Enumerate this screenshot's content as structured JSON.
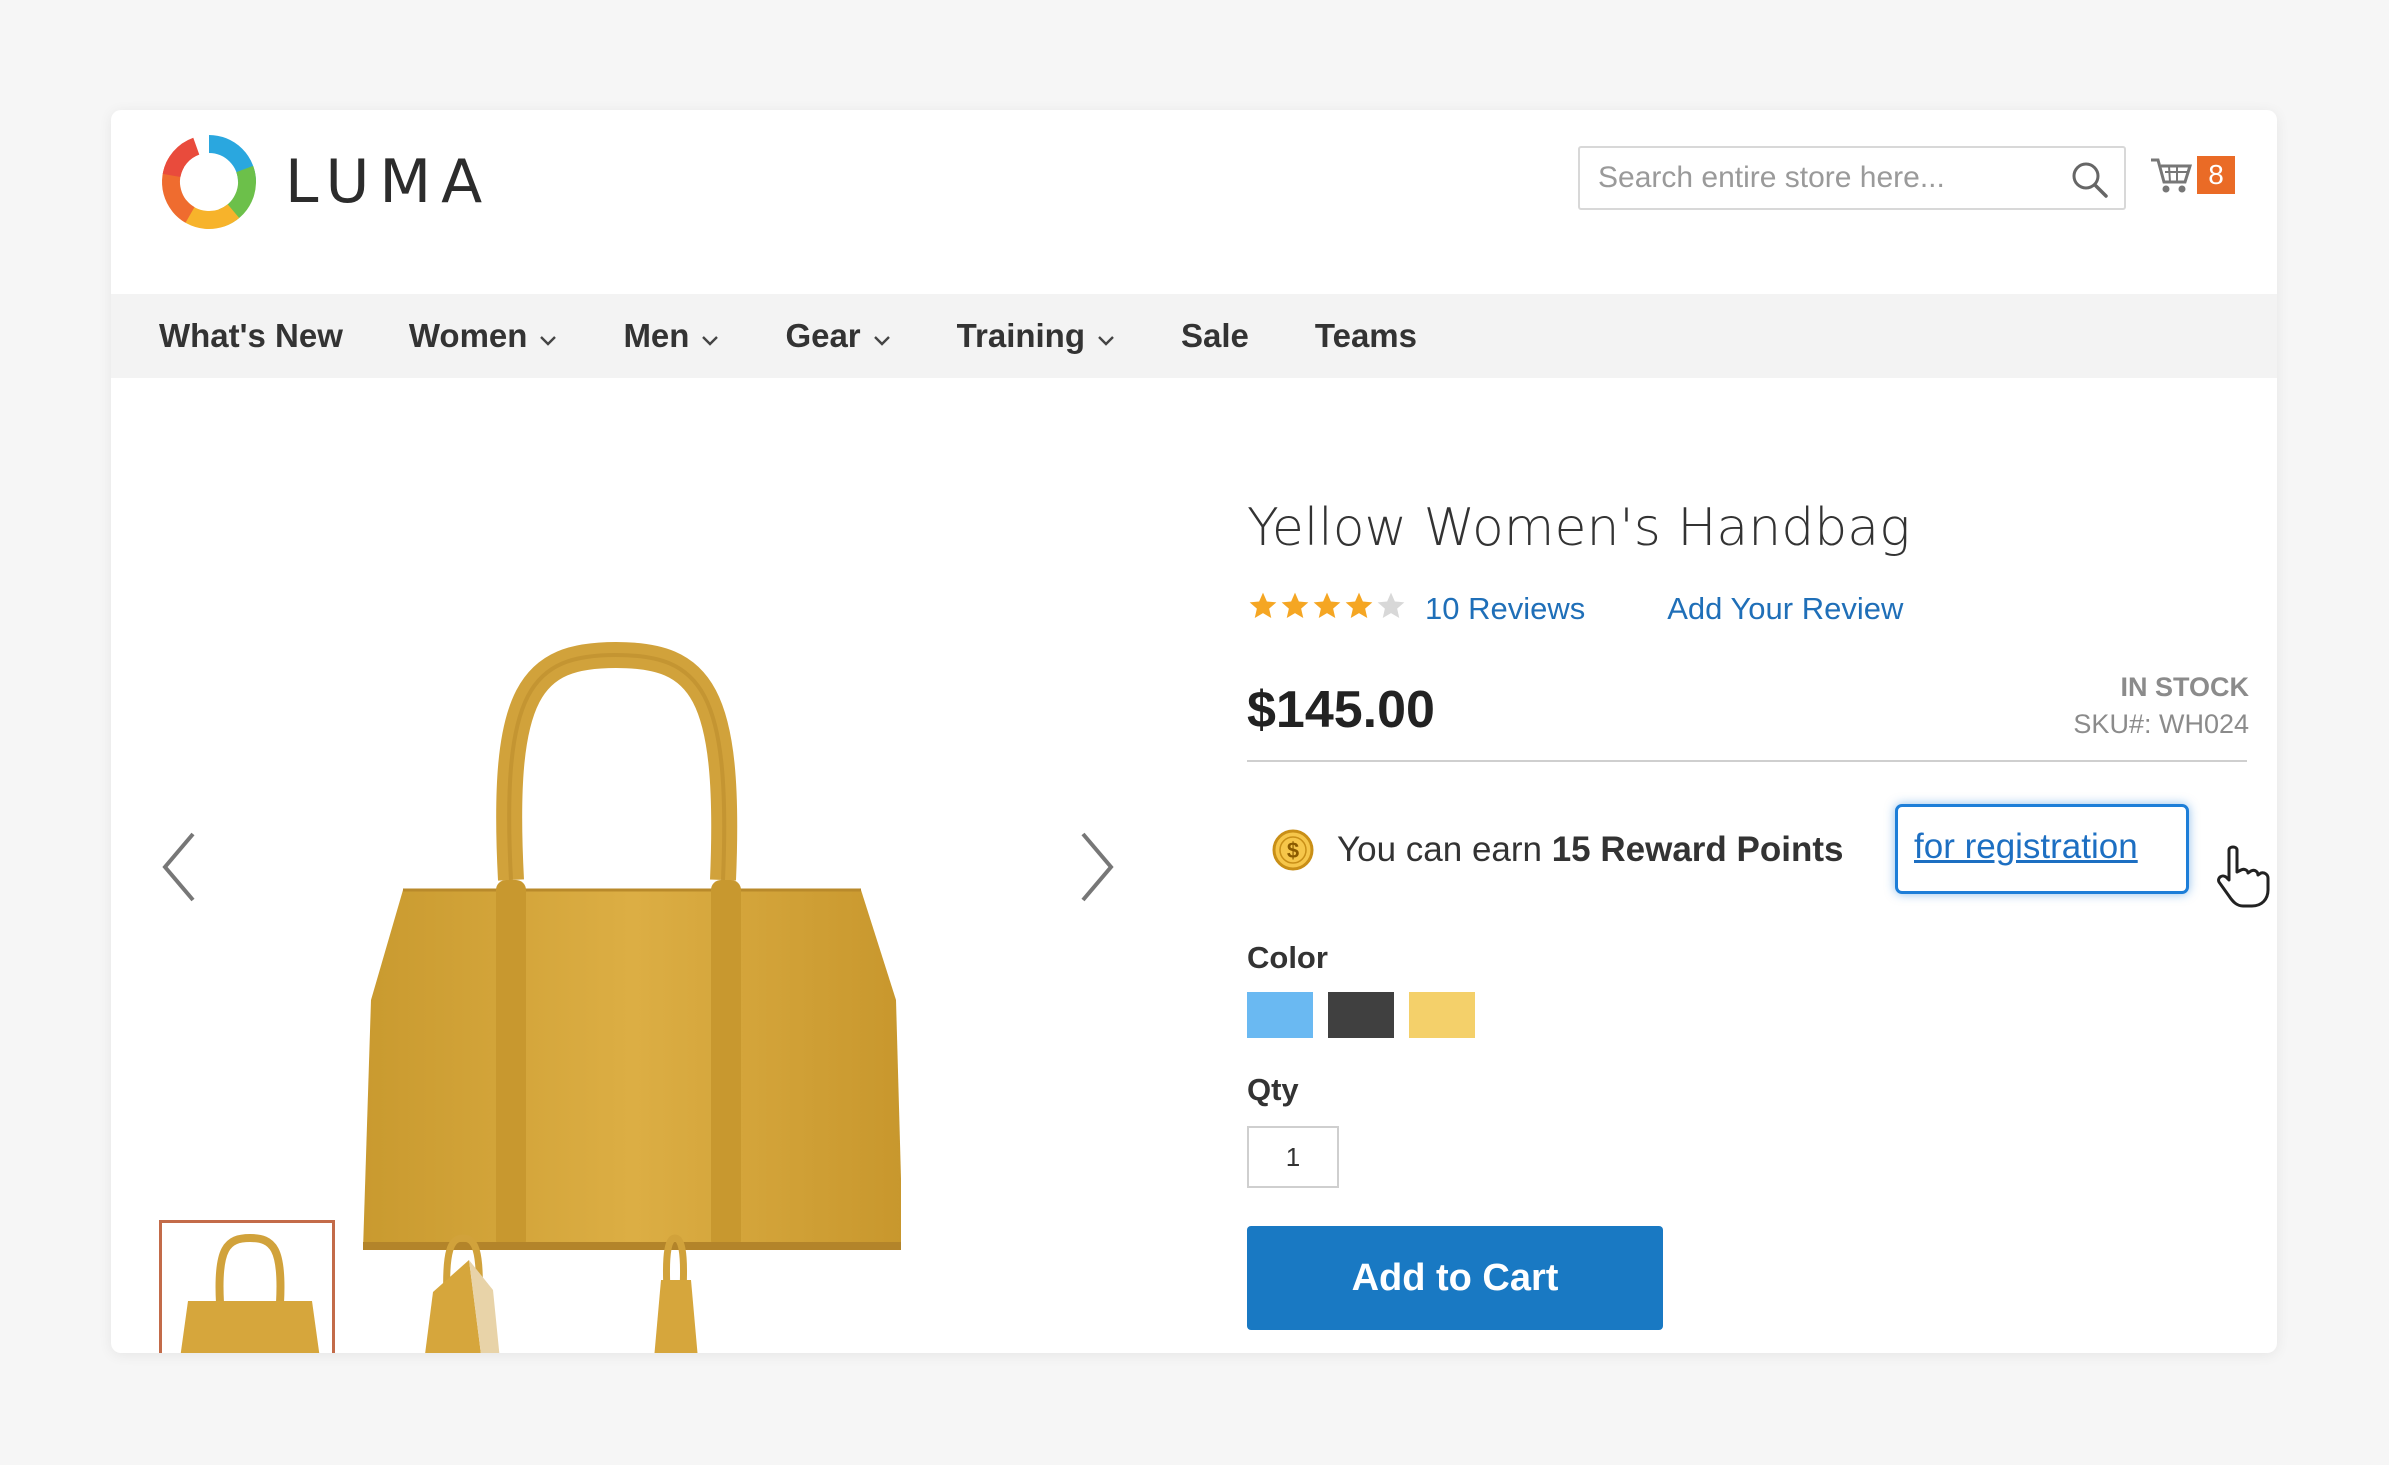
{
  "brand": {
    "name": "LUMA"
  },
  "search": {
    "placeholder": "Search entire store here..."
  },
  "cart": {
    "count": "8"
  },
  "nav": {
    "items": [
      {
        "label": "What's New",
        "dropdown": false
      },
      {
        "label": "Women",
        "dropdown": true
      },
      {
        "label": "Men",
        "dropdown": true
      },
      {
        "label": "Gear",
        "dropdown": true
      },
      {
        "label": "Training",
        "dropdown": true
      },
      {
        "label": "Sale",
        "dropdown": false
      },
      {
        "label": "Teams",
        "dropdown": false
      }
    ]
  },
  "product": {
    "title": "Yellow Women's Handbag",
    "rating": {
      "value": 4,
      "max": 5
    },
    "reviews_link": "10 Reviews",
    "add_review": "Add Your Review",
    "price": "$145.00",
    "stock_status": "IN STOCK",
    "sku": "SKU#: WH024",
    "reward": {
      "prefix": "You can earn ",
      "points": "15 Reward Points",
      "link": "for registration"
    },
    "color_label": "Color",
    "colors": [
      "#6ab9f2",
      "#404040",
      "#f4d06a"
    ],
    "qty_label": "Qty",
    "qty": "1",
    "add_to_cart": "Add to Cart"
  },
  "colors": {
    "accent": "#1979c3",
    "link": "#1f6fb8",
    "badge": "#ea6b26",
    "star": "#f5a623",
    "bag": "#d9a93a"
  }
}
